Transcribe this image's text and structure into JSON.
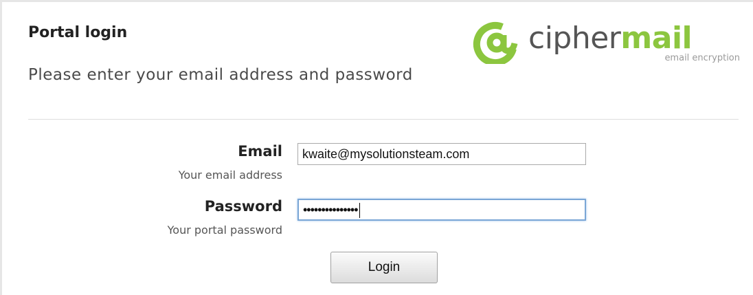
{
  "header": {
    "title": "Portal login",
    "subtitle": "Please enter your email address and password"
  },
  "logo": {
    "symbol": "@",
    "word_part1": "cipher",
    "word_part2": "mail",
    "tagline": "email encryption",
    "colors": {
      "green": "#8cc63f",
      "gray": "#555555"
    }
  },
  "form": {
    "email": {
      "label": "Email",
      "hint": "Your email address",
      "value": "kwaite@mysolutionsteam.com"
    },
    "password": {
      "label": "Password",
      "hint": "Your portal password",
      "masked_value": "•••••••••••••••"
    },
    "login_label": "Login"
  }
}
